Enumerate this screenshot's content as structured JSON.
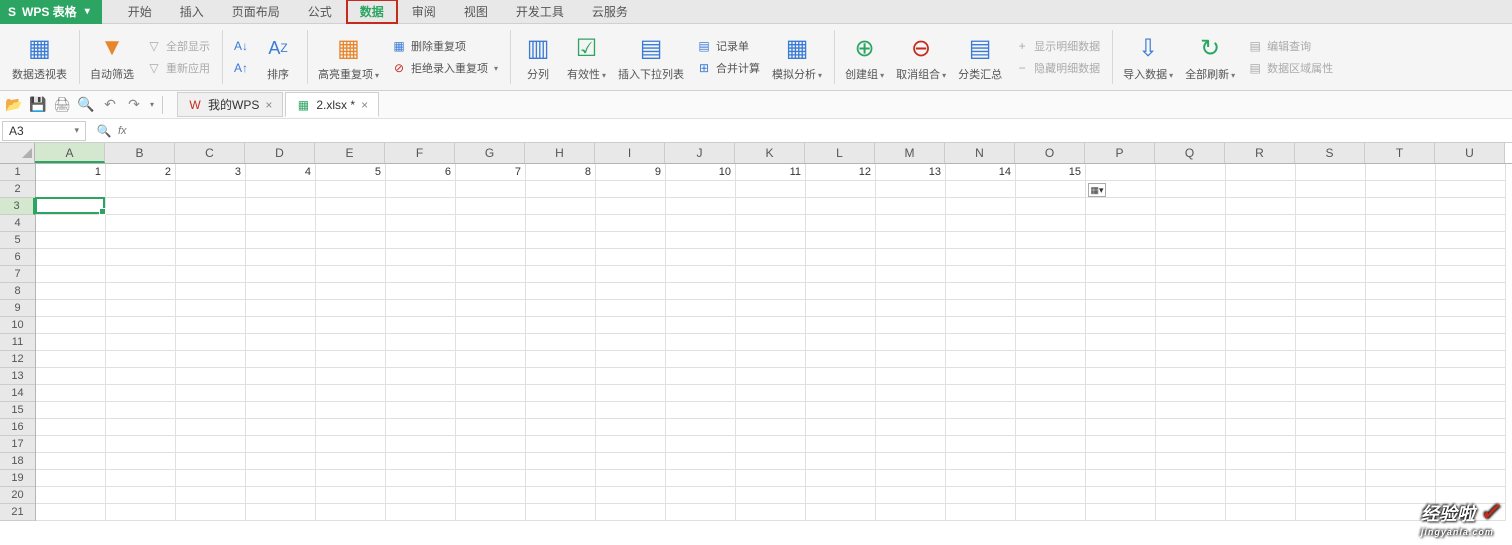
{
  "app": {
    "name": "WPS 表格"
  },
  "menu": {
    "items": [
      "开始",
      "插入",
      "页面布局",
      "公式",
      "数据",
      "审阅",
      "视图",
      "开发工具",
      "云服务"
    ],
    "active_index": 4
  },
  "ribbon": {
    "pivot": "数据透视表",
    "autofilter": "自动筛选",
    "show_all": "全部显示",
    "reapply": "重新应用",
    "sort": "排序",
    "highlight_dup": "高亮重复项",
    "remove_dup": "删除重复项",
    "reject_dup": "拒绝录入重复项",
    "text_to_cols": "分列",
    "validation": "有效性",
    "insert_dropdown": "插入下拉列表",
    "record_form": "记录单",
    "consolidate": "合并计算",
    "what_if": "模拟分析",
    "group": "创建组",
    "ungroup": "取消组合",
    "subtotal": "分类汇总",
    "show_detail": "显示明细数据",
    "hide_detail": "隐藏明细数据",
    "import_data": "导入数据",
    "refresh_all": "全部刷新",
    "edit_query": "编辑查询",
    "range_props": "数据区域属性"
  },
  "tabs": {
    "tab1": "我的WPS",
    "tab2": "2.xlsx *"
  },
  "formula": {
    "cell_ref": "A3",
    "fx": "fx",
    "value": ""
  },
  "columns": [
    "A",
    "B",
    "C",
    "D",
    "E",
    "F",
    "G",
    "H",
    "I",
    "J",
    "K",
    "L",
    "M",
    "N",
    "O",
    "P",
    "Q",
    "R",
    "S",
    "T",
    "U"
  ],
  "rows": [
    "1",
    "2",
    "3",
    "4",
    "5",
    "6",
    "7",
    "8",
    "9",
    "10",
    "11",
    "12",
    "13",
    "14",
    "15",
    "16",
    "17",
    "18",
    "19",
    "20",
    "21"
  ],
  "row1_data": [
    "1",
    "2",
    "3",
    "4",
    "5",
    "6",
    "7",
    "8",
    "9",
    "10",
    "11",
    "12",
    "13",
    "14",
    "15",
    "",
    "",
    "",
    "",
    "",
    ""
  ],
  "active": {
    "col_index": 0,
    "row_index": 2
  },
  "watermark": {
    "main": "经验啦",
    "sub": "jingyanla.com"
  }
}
